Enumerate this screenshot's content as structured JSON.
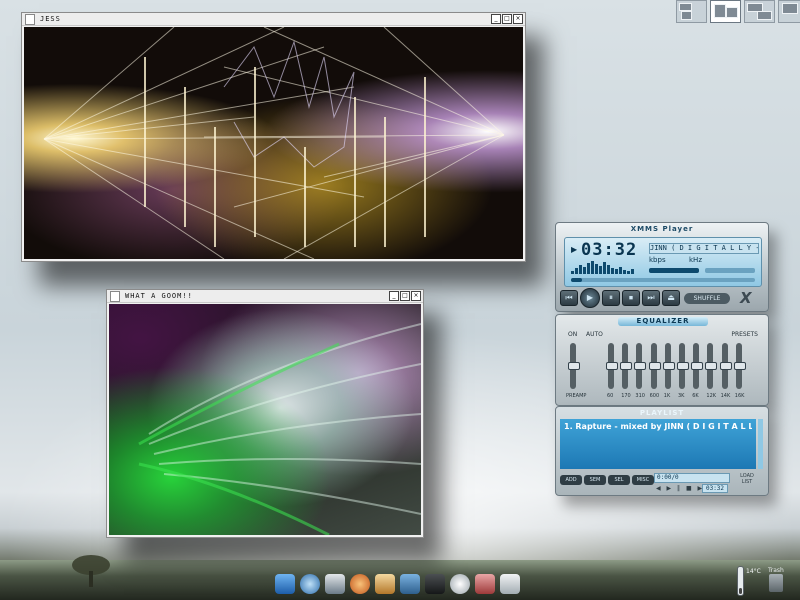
{
  "windows": {
    "jess": {
      "title": "JESS",
      "buttons": [
        "_",
        "□",
        "×"
      ]
    },
    "goom": {
      "title": "WHAT A GOOM!!",
      "buttons": [
        "_",
        "□",
        "×"
      ]
    }
  },
  "xmms": {
    "title": "XMMS Player",
    "time": "03:32",
    "play_indicator": "▶",
    "marquee": "JINN ( D I G I T A L L Y - I M",
    "kbps_label": "kbps",
    "khz_label": "kHz",
    "spectrum": [
      3,
      6,
      9,
      7,
      11,
      13,
      10,
      8,
      12,
      9,
      6,
      5,
      7,
      4,
      3,
      5
    ],
    "seek_fraction": 0.06,
    "controls": {
      "prev": "⏮",
      "play": "▶",
      "pause": "⏸",
      "stop": "⏹",
      "next": "⏭",
      "eject": "⏏"
    },
    "shuffle_label": "SHUFFLE",
    "logo": "X"
  },
  "equalizer": {
    "title": "EQUALIZER",
    "on_label": "ON",
    "auto_label": "AUTO",
    "presets_label": "PRESETS",
    "preamp_label": "PREAMP",
    "bands": [
      "60",
      "170",
      "310",
      "600",
      "1K",
      "3K",
      "6K",
      "12K",
      "14K",
      "16K"
    ]
  },
  "playlist": {
    "title": "PLAYLIST",
    "items": [
      "1. Rapture - mixed by JINN ( D I G I T A L L Y -..."
    ],
    "buttons": [
      "ADD",
      "SEM",
      "SEL",
      "MISC"
    ],
    "info": "0:00/0",
    "time": "03:32",
    "mini_controls": "◀ ▶ ‖ ■ ▶",
    "list_label": "LOAD LIST"
  },
  "tray": {
    "temperature": "14°C",
    "trash_label": "Trash"
  },
  "colors": {
    "xmms_accent": "#3fa3d7",
    "desktop": "#cdd7dc"
  }
}
